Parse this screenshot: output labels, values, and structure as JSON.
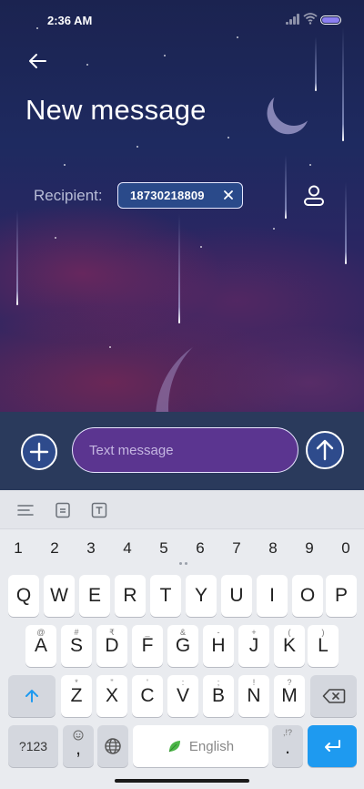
{
  "status_bar": {
    "time": "2:36 AM"
  },
  "header": {
    "title": "New message"
  },
  "recipient": {
    "label": "Recipient:",
    "chip": "18730218809"
  },
  "compose": {
    "placeholder": "Text message"
  },
  "keyboard": {
    "numbers": [
      "1",
      "2",
      "3",
      "4",
      "5",
      "6",
      "7",
      "8",
      "9",
      "0"
    ],
    "row1": [
      "Q",
      "W",
      "E",
      "R",
      "T",
      "Y",
      "U",
      "I",
      "O",
      "P"
    ],
    "row2": [
      "A",
      "S",
      "D",
      "F",
      "G",
      "H",
      "J",
      "K",
      "L"
    ],
    "row2_sub": [
      "@",
      "#",
      "₹",
      "_",
      "&",
      "-",
      "+",
      "(",
      ")"
    ],
    "row3": [
      "Z",
      "X",
      "C",
      "V",
      "B",
      "N",
      "M"
    ],
    "row3_sub": [
      "*",
      "\"",
      "'",
      ":",
      ";",
      "!",
      "?"
    ],
    "symbols_label": "?123",
    "comma_label": ",",
    "space_label": "English",
    "period_label": ".",
    "period_sub": ",!?"
  },
  "colors": {
    "accent": "#1e9af0",
    "chip_bg": "#2a4a8a",
    "field_bg": "#5b3590"
  }
}
